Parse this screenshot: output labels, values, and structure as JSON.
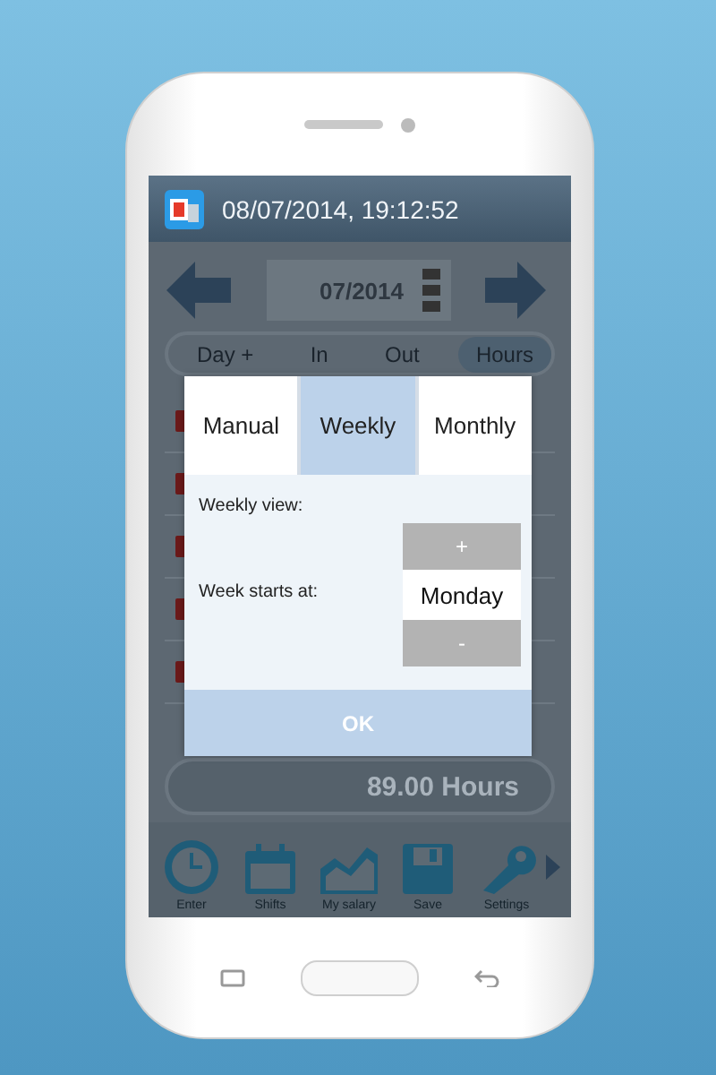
{
  "status": {
    "datetime": "08/07/2014, 19:12:52"
  },
  "month": {
    "value": "07/2014"
  },
  "columns": [
    {
      "label": "Day +",
      "highlighted": false
    },
    {
      "label": "In",
      "highlighted": false
    },
    {
      "label": "Out",
      "highlighted": false
    },
    {
      "label": "Hours",
      "highlighted": true
    }
  ],
  "total": "89.00 Hours",
  "toolbar": [
    {
      "label": "Enter",
      "kind": "clock"
    },
    {
      "label": "Shifts",
      "kind": "calendar"
    },
    {
      "label": "My salary",
      "kind": "chart"
    },
    {
      "label": "Save",
      "kind": "disk"
    },
    {
      "label": "Settings",
      "kind": "wrench"
    }
  ],
  "dialog": {
    "tabs": [
      {
        "label": "Manual",
        "selected": false
      },
      {
        "label": "Weekly",
        "selected": true
      },
      {
        "label": "Monthly",
        "selected": false
      }
    ],
    "fields": [
      {
        "kind": "heading",
        "label": "Weekly view:"
      },
      {
        "kind": "spinner",
        "label": "Week starts at:",
        "value": "Monday",
        "up": "+",
        "down": "-"
      }
    ],
    "ok": "OK"
  }
}
